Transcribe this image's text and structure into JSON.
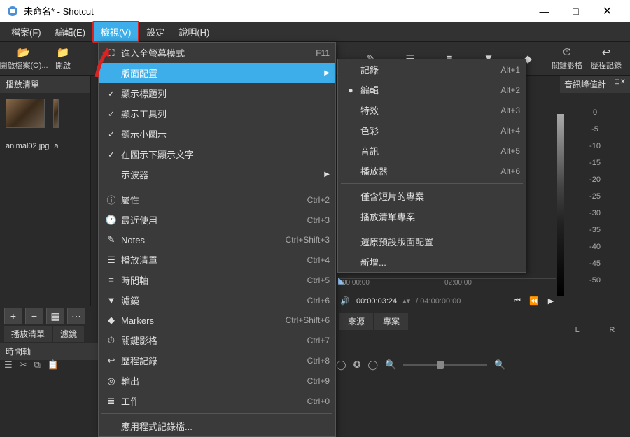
{
  "window": {
    "title": "未命名* - Shotcut",
    "minimize": "—",
    "maximize": "□",
    "close": "✕"
  },
  "menubar": {
    "file": "檔案(F)",
    "edit": "編輯(E)",
    "view": "檢視(V)",
    "settings": "設定",
    "help": "說明(H)"
  },
  "toolbar": {
    "open": "開啟檔案(O)...",
    "open2": "開啟",
    "keyframes": "關鍵影格",
    "history": "歷程記錄"
  },
  "viewmenu": {
    "fullscreen": {
      "label": "進入全螢幕模式",
      "shortcut": "F11"
    },
    "layout": {
      "label": "版面配置"
    },
    "titlebar": {
      "label": "顯示標題列"
    },
    "toolbar": {
      "label": "顯示工具列"
    },
    "smallicons": {
      "label": "顯示小圖示"
    },
    "textundericons": {
      "label": "在圖示下顯示文字"
    },
    "scopes": {
      "label": "示波器"
    },
    "properties": {
      "label": "屬性",
      "shortcut": "Ctrl+2"
    },
    "recent": {
      "label": "最近使用",
      "shortcut": "Ctrl+3"
    },
    "notes": {
      "label": "Notes",
      "shortcut": "Ctrl+Shift+3"
    },
    "playlist": {
      "label": "播放清單",
      "shortcut": "Ctrl+4"
    },
    "timeline": {
      "label": "時間軸",
      "shortcut": "Ctrl+5"
    },
    "filters": {
      "label": "濾鏡",
      "shortcut": "Ctrl+6"
    },
    "markers": {
      "label": "Markers",
      "shortcut": "Ctrl+Shift+6"
    },
    "keyframes": {
      "label": "關鍵影格",
      "shortcut": "Ctrl+7"
    },
    "history": {
      "label": "歷程記錄",
      "shortcut": "Ctrl+8"
    },
    "export": {
      "label": "輸出",
      "shortcut": "Ctrl+9"
    },
    "jobs": {
      "label": "工作",
      "shortcut": "Ctrl+0"
    },
    "applog": {
      "label": "應用程式記錄檔..."
    }
  },
  "layoutmenu": {
    "logging": {
      "label": "記錄",
      "shortcut": "Alt+1"
    },
    "editing": {
      "label": "編輯",
      "shortcut": "Alt+2"
    },
    "fx": {
      "label": "特效",
      "shortcut": "Alt+3"
    },
    "color": {
      "label": "色彩",
      "shortcut": "Alt+4"
    },
    "audio": {
      "label": "音訊",
      "shortcut": "Alt+5"
    },
    "player": {
      "label": "播放器",
      "shortcut": "Alt+6"
    },
    "cliponly": {
      "label": "僅含短片的專案"
    },
    "playlistproj": {
      "label": "播放清單專案"
    },
    "restore": {
      "label": "還原預設版面配置"
    },
    "add": {
      "label": "新增..."
    }
  },
  "playlist": {
    "header": "播放清單",
    "thumb1": "animal02.jpg",
    "thumb2": "a"
  },
  "peak": {
    "header": "音訊峰值計",
    "ticks": [
      "0",
      "-5",
      "-10",
      "-15",
      "-20",
      "-25",
      "-30",
      "-35",
      "-40",
      "-45",
      "-50"
    ],
    "lr": "L    R"
  },
  "bottom": {
    "playlist_tab": "播放清單",
    "filters_tab": "濾鏡",
    "timeline_header": "時間軸",
    "source_tab": "來源",
    "project_tab": "專案",
    "time1": "00:00:00",
    "time2": "02:00:00",
    "current": "00:00:03:24",
    "total": "/ 04:00:00:00"
  }
}
